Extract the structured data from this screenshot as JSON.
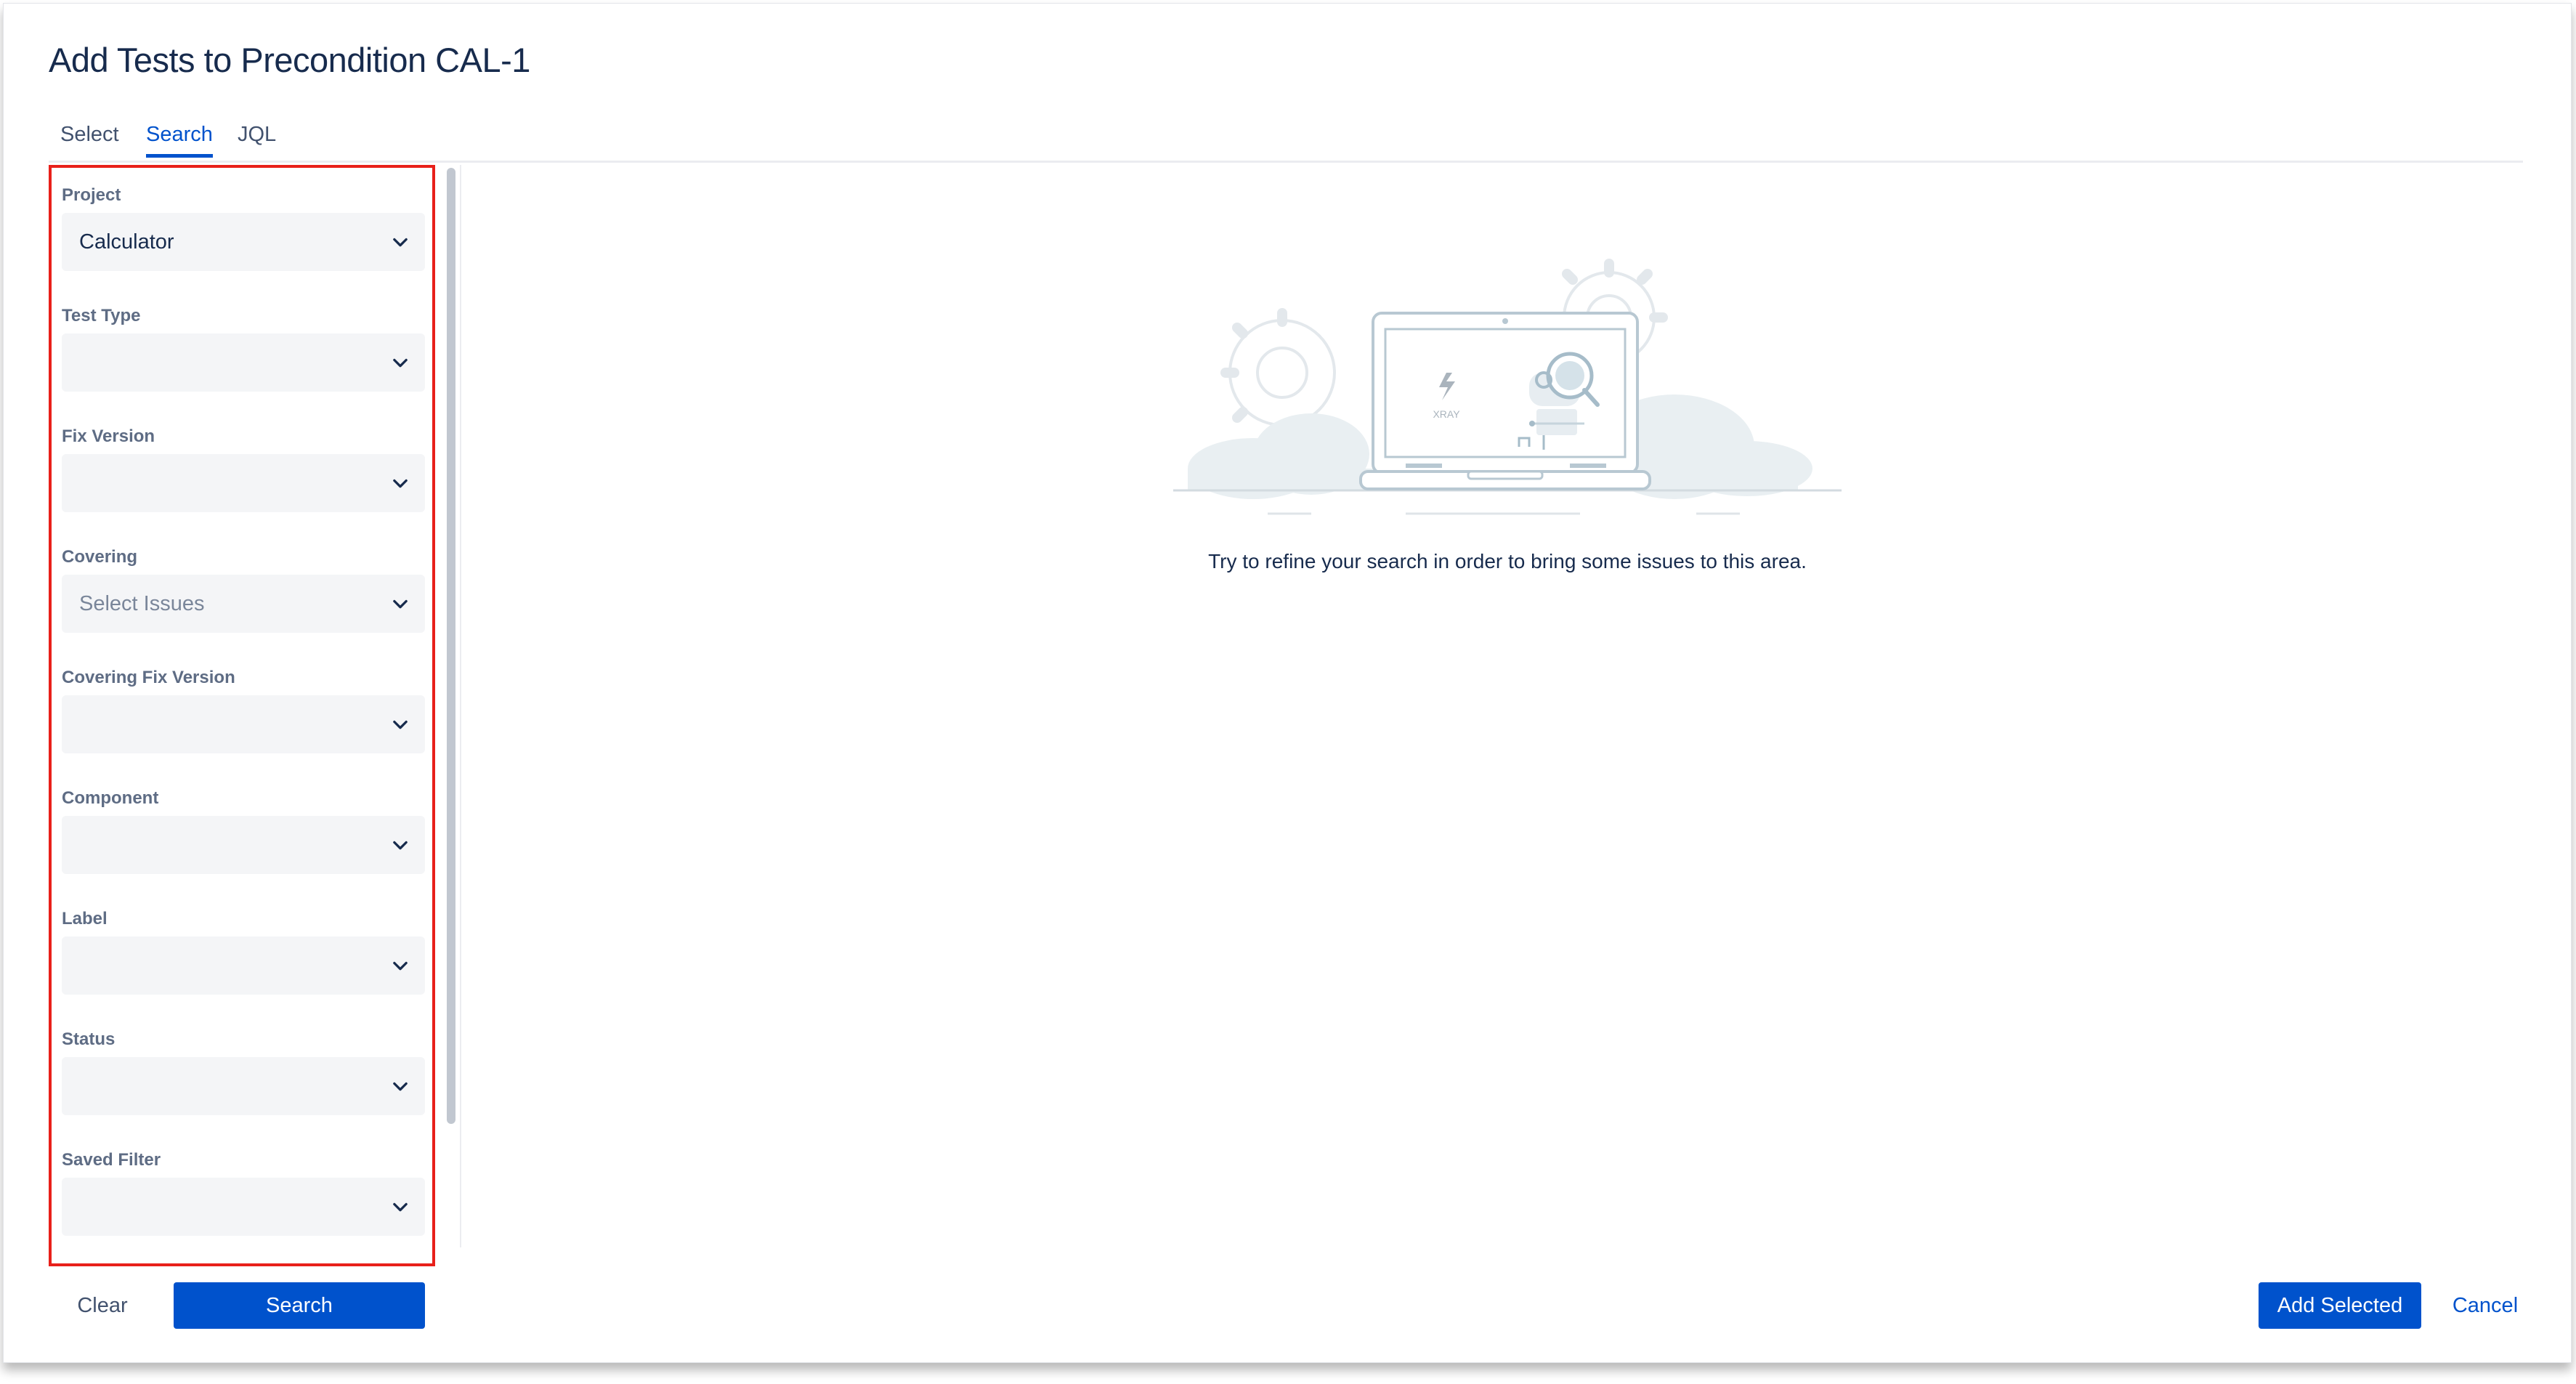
{
  "dialog": {
    "title": "Add Tests to Precondition CAL-1"
  },
  "tabs": [
    {
      "label": "Select",
      "active": false
    },
    {
      "label": "Search",
      "active": true
    },
    {
      "label": "JQL",
      "active": false
    }
  ],
  "filters": [
    {
      "label": "Project",
      "value": "Calculator",
      "placeholder": ""
    },
    {
      "label": "Test Type",
      "value": "",
      "placeholder": ""
    },
    {
      "label": "Fix Version",
      "value": "",
      "placeholder": ""
    },
    {
      "label": "Covering",
      "value": "",
      "placeholder": "Select Issues"
    },
    {
      "label": "Covering Fix Version",
      "value": "",
      "placeholder": ""
    },
    {
      "label": "Component",
      "value": "",
      "placeholder": ""
    },
    {
      "label": "Label",
      "value": "",
      "placeholder": ""
    },
    {
      "label": "Status",
      "value": "",
      "placeholder": ""
    },
    {
      "label": "Saved Filter",
      "value": "",
      "placeholder": ""
    }
  ],
  "empty_state": {
    "illustration_text": "XRAY",
    "message": "Try to refine your search in order to bring some issues to this area."
  },
  "footer": {
    "clear_label": "Clear",
    "search_label": "Search",
    "add_selected_label": "Add Selected",
    "cancel_label": "Cancel"
  },
  "colors": {
    "primary": "#0052cc",
    "highlight_border": "#e8201a",
    "field_bg": "#f4f5f7"
  },
  "icons": {
    "dropdown": "chevron-down-icon"
  }
}
